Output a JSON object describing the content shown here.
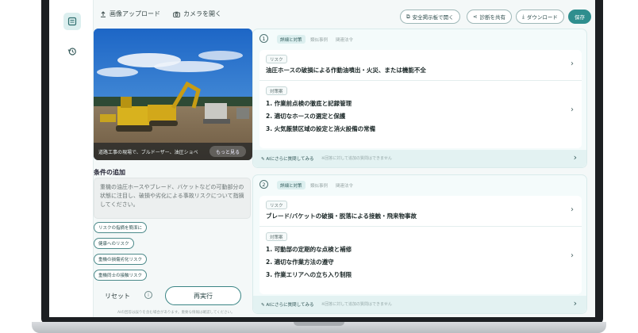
{
  "toolbar": {
    "upload_label": "画像アップロード",
    "camera_label": "カメラを開く",
    "safety_board_label": "安全掲示板で開く",
    "share_label": "診断を共有",
    "download_label": "ダウンロード",
    "save_label": "保存"
  },
  "photo": {
    "caption": "道路工事の現場で、ブルドーザー、油圧ショベ",
    "caption_button": "もっと見る"
  },
  "conditions": {
    "title": "条件の追加",
    "placeholder": "重機の油圧ホースやブレード、バケットなどの可動部分の状態に注目し、破損や劣化による事故リスクについて指摘してください。",
    "chips": [
      "リスクの指摘を簡潔に",
      "健康へのリスク",
      "重機の損傷劣化リスク",
      "重機同士の接触リスク"
    ],
    "reset_label": "リセット",
    "rerun_label": "再実行",
    "footnote": "AIの回答は誤りを含む場合があります。重要な情報は確認してください。"
  },
  "cards": [
    {
      "number": "①",
      "tabs": [
        "詳細と対策",
        "類似事例",
        "関連法令"
      ],
      "risk_label": "リスク",
      "risk_text": "油圧ホースの破損による作動油噴出・火災、または機能不全",
      "measures_label": "対策案",
      "measures": [
        "1. 作業前点検の徹底と記録管理",
        "2. 適切なホースの選定と保護",
        "3. 火気厳禁区域の設定と消火設備の常備"
      ],
      "ask_label": "AIにさらに質問してみる",
      "ask_note": "※回答に対して追加の質問はできません"
    },
    {
      "number": "②",
      "tabs": [
        "詳細と対策",
        "類似事例",
        "関連法令"
      ],
      "risk_label": "リスク",
      "risk_text": "ブレード/バケットの破損・脱落による接触・飛来物事故",
      "measures_label": "対策案",
      "measures": [
        "1. 可動部の定期的な点検と補修",
        "2. 適切な作業方法の遵守",
        "3. 作業エリアへの立ち入り制限"
      ],
      "ask_label": "AIにさらに質問してみる",
      "ask_note": "※回答に対して追加の質問はできません"
    }
  ],
  "colors": {
    "accent": "#2f8e8e",
    "card_bg": "#f4fbfb",
    "ask_bg": "#e3f2f2"
  }
}
